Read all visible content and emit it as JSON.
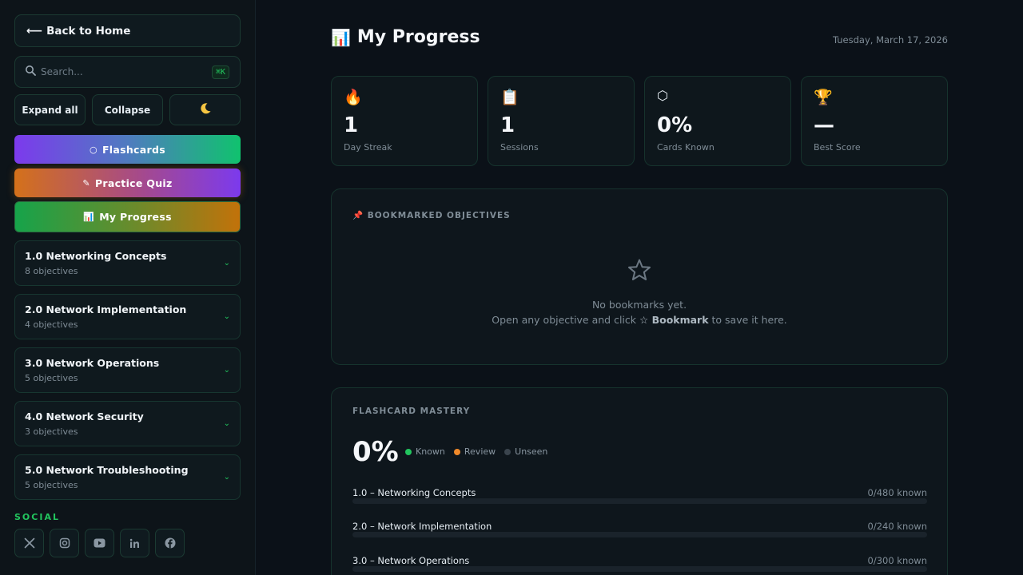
{
  "sidebar": {
    "back_label": "Back to Home",
    "search_placeholder": "Search...",
    "search_shortcut": "⌘K",
    "expand_label": "Expand all",
    "collapse_label": "Collapse",
    "theme_icon": "moon-icon",
    "nav": [
      {
        "icon": "○",
        "label": "Flashcards"
      },
      {
        "icon": "✎",
        "label": "Practice Quiz"
      },
      {
        "icon": "📊",
        "label": "My Progress"
      }
    ],
    "sections": [
      {
        "title": "1.0 Networking Concepts",
        "subtitle": "8 objectives"
      },
      {
        "title": "2.0 Network Implementation",
        "subtitle": "4 objectives"
      },
      {
        "title": "3.0 Network Operations",
        "subtitle": "5 objectives"
      },
      {
        "title": "4.0 Network Security",
        "subtitle": "3 objectives"
      },
      {
        "title": "5.0 Network Troubleshooting",
        "subtitle": "5 objectives"
      }
    ],
    "social_label": "SOCIAL",
    "social": [
      "x-icon",
      "instagram-icon",
      "youtube-icon",
      "linkedin-icon",
      "facebook-icon"
    ]
  },
  "header": {
    "title_icon": "📊",
    "title": "My Progress",
    "date": "Tuesday, March 17, 2026"
  },
  "stats": [
    {
      "icon": "🔥",
      "value": "1",
      "label": "Day Streak"
    },
    {
      "icon": "📋",
      "value": "1",
      "label": "Sessions"
    },
    {
      "icon": "⬡",
      "value": "0%",
      "label": "Cards Known"
    },
    {
      "icon": "🏆",
      "value": "—",
      "label": "Best Score"
    }
  ],
  "bookmarks": {
    "title": "📌 BOOKMARKED OBJECTIVES",
    "empty_line1": "No bookmarks yet.",
    "empty_line2_pre": "Open any objective and click",
    "empty_line2_bold": "☆ Bookmark",
    "empty_line2_post": "to save it here."
  },
  "mastery": {
    "title": "FLASHCARD MASTERY",
    "percent": "0%",
    "legend": [
      {
        "label": "Known",
        "color": "#22c55e"
      },
      {
        "label": "Review",
        "color": "#f0892a"
      },
      {
        "label": "Unseen",
        "color": "#3a444d"
      }
    ],
    "rows": [
      {
        "name": "1.0 – Networking Concepts",
        "known": "0/480 known",
        "fraction": 0
      },
      {
        "name": "2.0 – Network Implementation",
        "known": "0/240 known",
        "fraction": 0
      },
      {
        "name": "3.0 – Network Operations",
        "known": "0/300 known",
        "fraction": 0
      }
    ]
  }
}
